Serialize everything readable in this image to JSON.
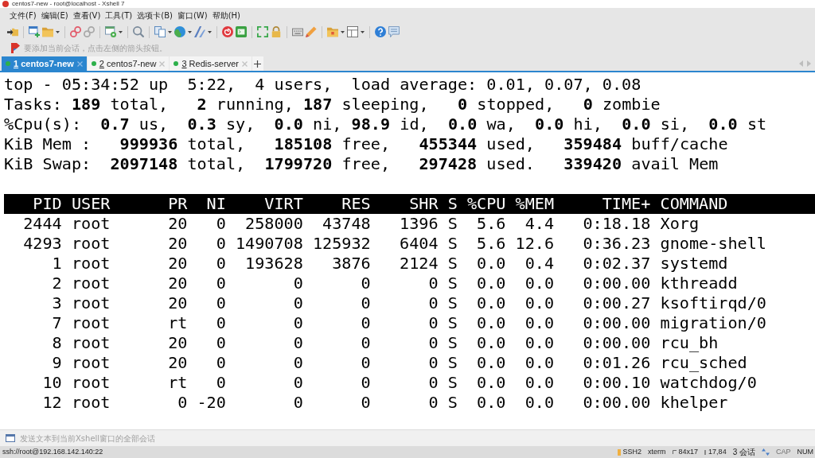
{
  "window": {
    "title": "centos7-new - root@localhost - Xshell 7"
  },
  "menu_bar": [
    "文件(F)",
    "编辑(E)",
    "查看(V)",
    "工具(T)",
    "选项卡(B)",
    "窗口(W)",
    "帮助(H)"
  ],
  "address_bar": {
    "placeholder": "要添加当前会话，点击左侧的箭头按钮。"
  },
  "tabs": [
    {
      "number": "1",
      "label": "centos7-new",
      "selected": true
    },
    {
      "number": "2",
      "label": "centos7-new",
      "selected": false
    },
    {
      "number": "3",
      "label": "Redis-server",
      "selected": false
    }
  ],
  "terminal": {
    "summary": [
      "top - 05:34:52 up  5:22,  4 users,  load average: 0.01, 0.07, 0.08",
      "Tasks: **189** total,   **2** running, **187** sleeping,   **0** stopped,   **0** zombie",
      "%Cpu(s):  **0.7** us,  **0.3** sy,  **0.0** ni, **98.9** id,  **0.0** wa,  **0.0** hi,  **0.0** si,  **0.0** st",
      "KiB Mem :   **999936** total,   **185108** free,   **455344** used,   **359484** buff/cache",
      "KiB Swap:  **2097148** total,  **1799720** free,   **297428** used.   **339420** avail Mem"
    ],
    "table": {
      "columns": [
        "PID",
        "USER",
        "PR",
        "NI",
        "VIRT",
        "RES",
        "SHR",
        "S",
        "%CPU",
        "%MEM",
        "TIME+",
        "COMMAND"
      ],
      "rows": [
        [
          "2444",
          "root",
          "20",
          "0",
          "258000",
          "43748",
          "1396",
          "S",
          "5.6",
          "4.4",
          "0:18.18",
          "Xorg"
        ],
        [
          "4293",
          "root",
          "20",
          "0",
          "1490708",
          "125932",
          "6404",
          "S",
          "5.6",
          "12.6",
          "0:36.23",
          "gnome-shell"
        ],
        [
          "1",
          "root",
          "20",
          "0",
          "193628",
          "3876",
          "2124",
          "S",
          "0.0",
          "0.4",
          "0:02.37",
          "systemd"
        ],
        [
          "2",
          "root",
          "20",
          "0",
          "0",
          "0",
          "0",
          "S",
          "0.0",
          "0.0",
          "0:00.00",
          "kthreadd"
        ],
        [
          "3",
          "root",
          "20",
          "0",
          "0",
          "0",
          "0",
          "S",
          "0.0",
          "0.0",
          "0:00.27",
          "ksoftirqd/0"
        ],
        [
          "7",
          "root",
          "rt",
          "0",
          "0",
          "0",
          "0",
          "S",
          "0.0",
          "0.0",
          "0:00.00",
          "migration/0"
        ],
        [
          "8",
          "root",
          "20",
          "0",
          "0",
          "0",
          "0",
          "S",
          "0.0",
          "0.0",
          "0:00.00",
          "rcu_bh"
        ],
        [
          "9",
          "root",
          "20",
          "0",
          "0",
          "0",
          "0",
          "S",
          "0.0",
          "0.0",
          "0:01.26",
          "rcu_sched"
        ],
        [
          "10",
          "root",
          "rt",
          "0",
          "0",
          "0",
          "0",
          "S",
          "0.0",
          "0.0",
          "0:00.10",
          "watchdog/0"
        ],
        [
          "12",
          "root",
          "0",
          "-20",
          "0",
          "0",
          "0",
          "S",
          "0.0",
          "0.0",
          "0:00.00",
          "khelper"
        ]
      ]
    }
  },
  "compose_bar": {
    "placeholder": "发送文本到当前Xshell窗口的全部会话"
  },
  "status_bar": {
    "address": "ssh://root@192.168.142.140:22",
    "protocol": "SSH2",
    "terminal_type": "xterm",
    "size": "84x17",
    "cursor": "17,84",
    "sessions": "3 会话",
    "caps_lock": {
      "label": "CAP",
      "on": false
    },
    "num_lock": {
      "label": "NUM",
      "on": true
    }
  }
}
